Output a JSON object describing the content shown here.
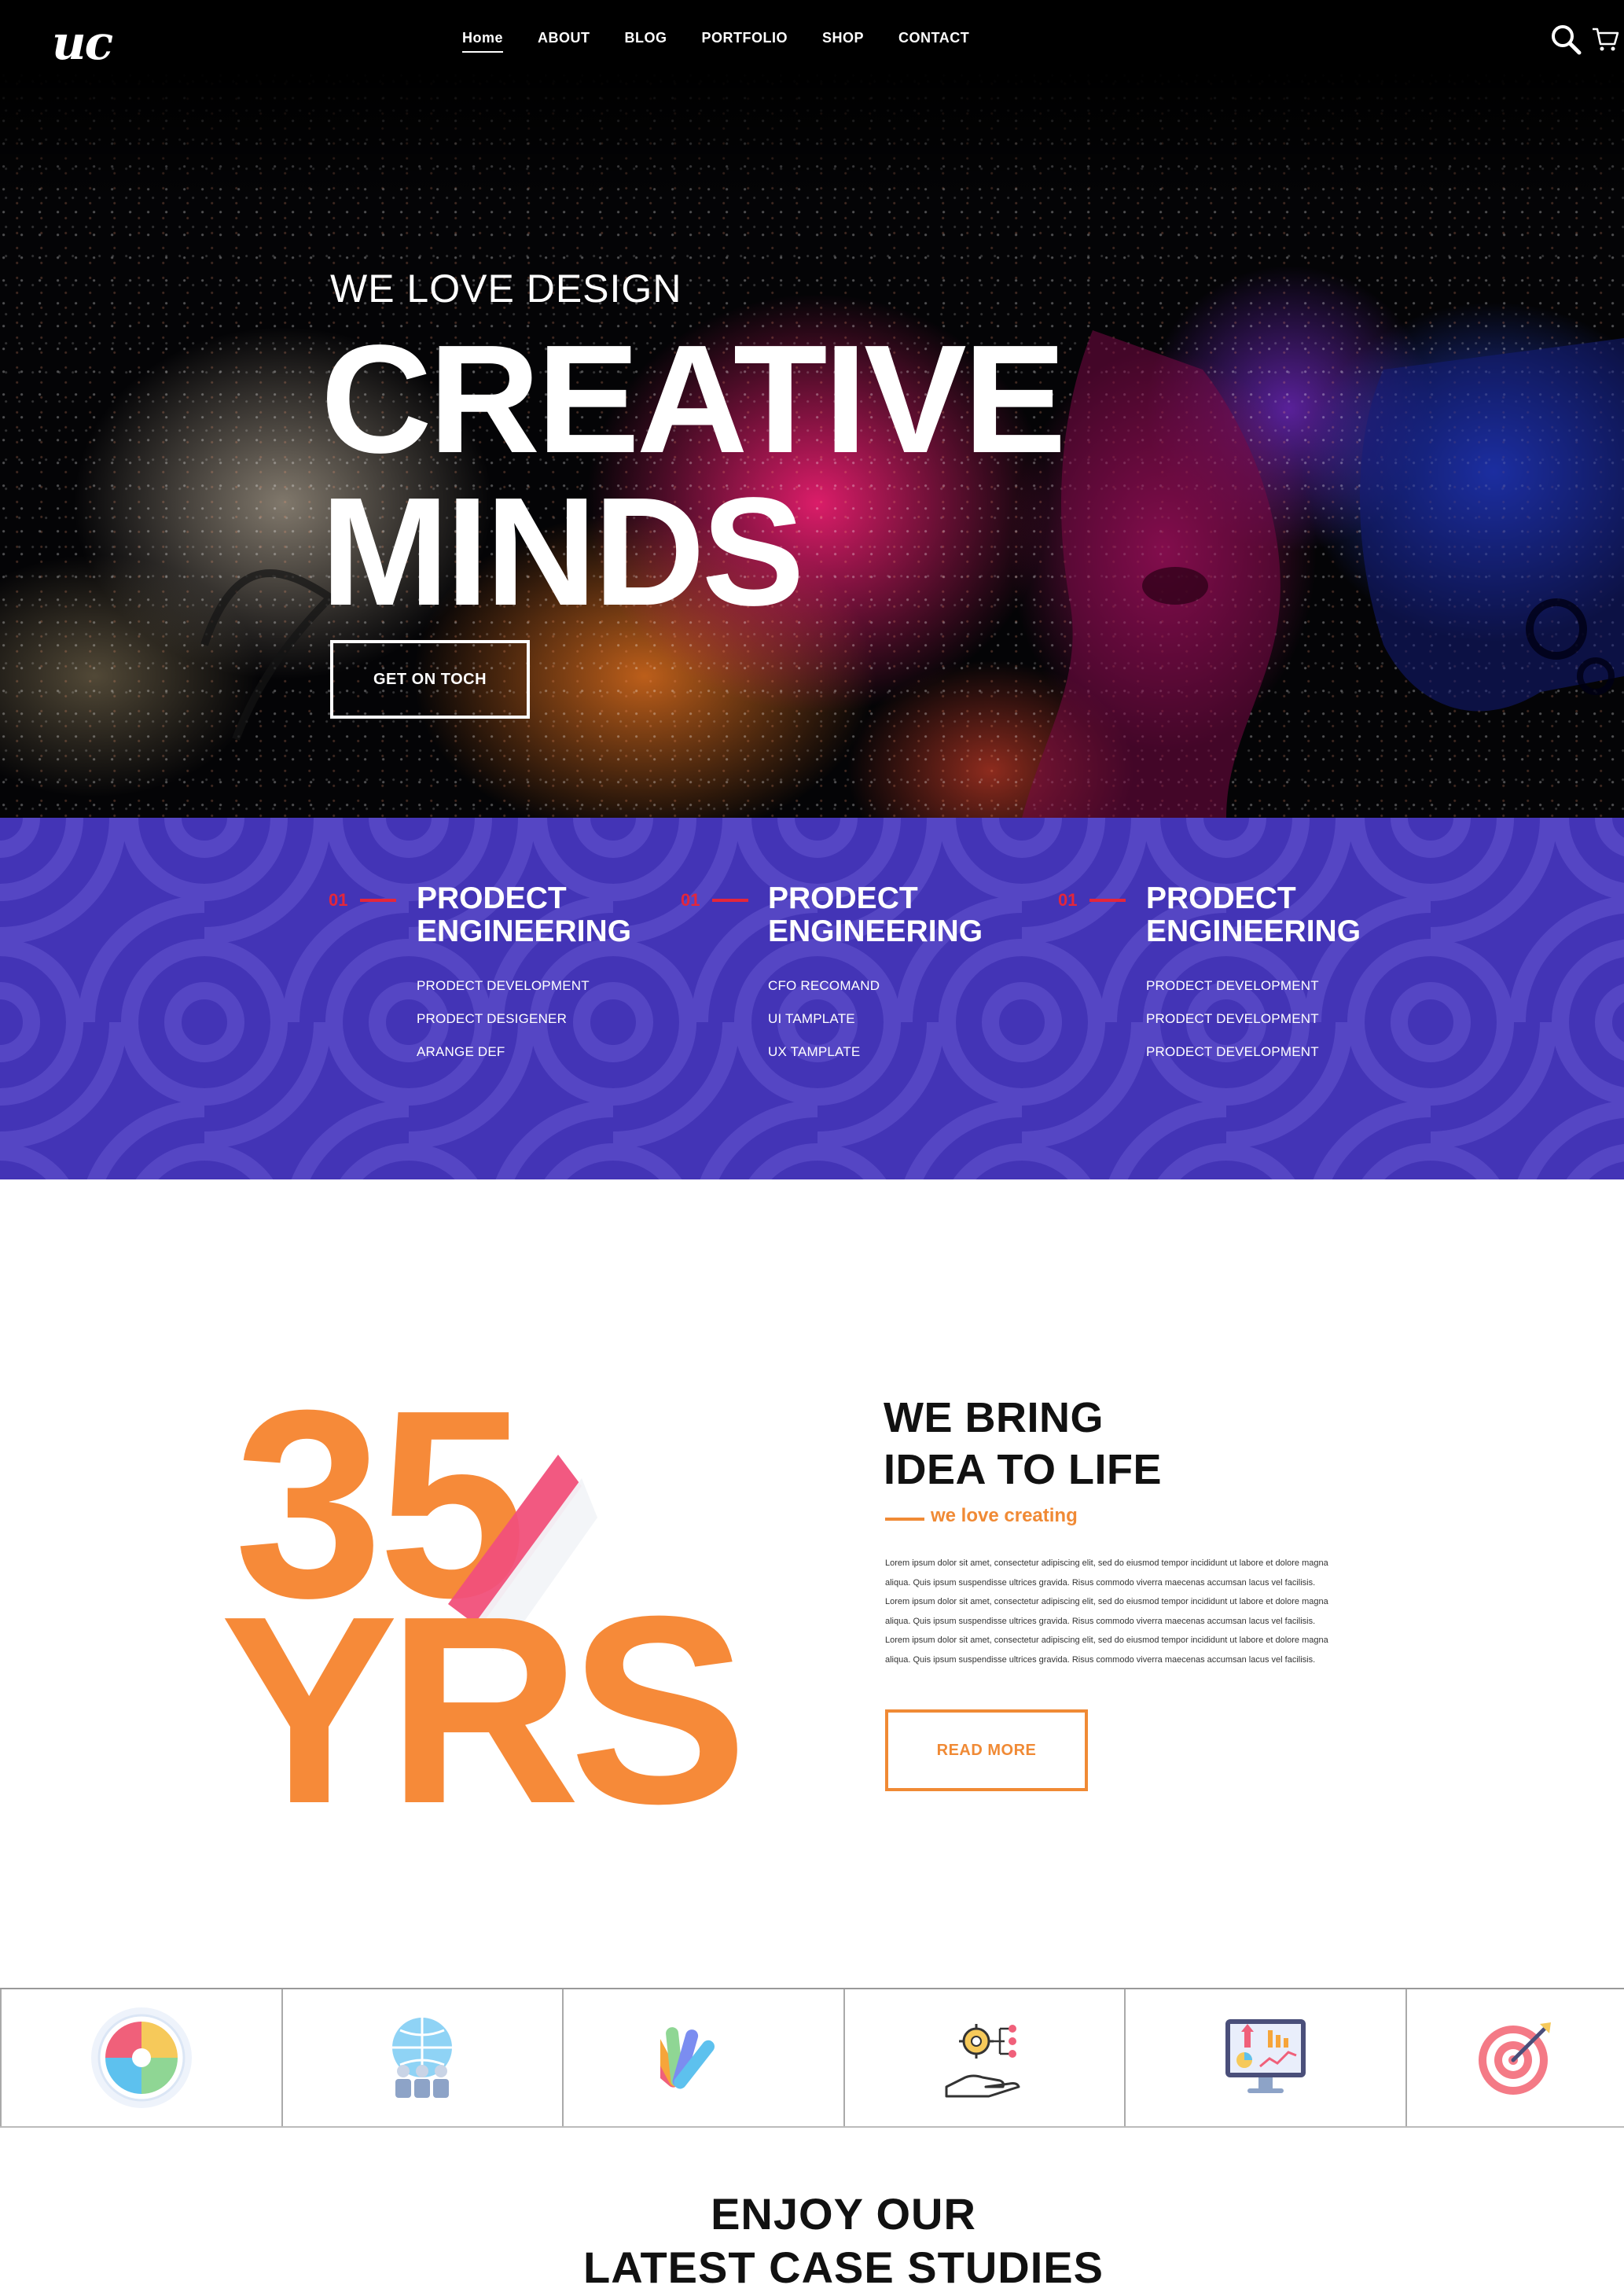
{
  "brand": {
    "logo": "uc"
  },
  "nav": {
    "items": [
      "Home",
      "ABOUT",
      "BLOG",
      "PORTFOLIO",
      "SHOP",
      "CONTACT"
    ]
  },
  "header_icons": {
    "search": "search-icon",
    "cart": "cart-icon"
  },
  "hero": {
    "subtitle": "WE LOVE DESIGN",
    "title_line1": "CREATIVE",
    "title_line2": "MINDS",
    "button": "GET ON TOCH"
  },
  "services": [
    {
      "num": "01",
      "title1": "PRODECT",
      "title2": "ENGINEERING",
      "items": [
        "PRODECT DEVELOPMENT",
        "PRODECT DESIGENER",
        "ARANGE DEF"
      ]
    },
    {
      "num": "01",
      "title1": "PRODECT",
      "title2": "ENGINEERING",
      "items": [
        "CFO RECOMAND",
        "UI TAMPLATE",
        "UX TAMPLATE"
      ]
    },
    {
      "num": "01",
      "title1": "PRODECT",
      "title2": "ENGINEERING",
      "items": [
        "PRODECT DEVELOPMENT",
        "PRODECT DEVELOPMENT",
        "PRODECT DEVELOPMENT"
      ]
    }
  ],
  "about": {
    "graphic": {
      "num": "35",
      "word": "YRS"
    },
    "heading1": "WE BRING",
    "heading2": "IDEA TO LIFE",
    "tagline": "we love creating",
    "body": "Lorem ipsum dolor sit amet, consectetur adipiscing elit, sed do eiusmod tempor incididunt ut labore et dolore magna aliqua. Quis ipsum suspendisse ultrices gravida. Risus commodo viverra maecenas accumsan lacus vel facilisis. Lorem ipsum dolor sit amet, consectetur adipiscing elit, sed do eiusmod tempor incididunt ut labore et dolore magna aliqua. Quis ipsum suspendisse ultrices gravida. Risus commodo viverra maecenas accumsan lacus vel facilisis. Lorem ipsum dolor sit amet, consectetur adipiscing elit, sed do eiusmod tempor incididunt ut labore et dolore magna aliqua. Quis ipsum suspendisse ultrices gravida. Risus commodo viverra maecenas accumsan lacus vel facilisis.",
    "button": "READ MORE"
  },
  "feature_icons": [
    "puzzle-icon",
    "global-team-icon",
    "color-palette-icon",
    "gear-hand-icon",
    "analytics-monitor-icon",
    "target-icon"
  ],
  "case_studies": {
    "heading1": "ENJOY OUR",
    "heading2": "LATEST CASE STUDIES"
  },
  "colors": {
    "accent_orange": "#f08a35",
    "accent_red": "#e5263a",
    "band_purple": "#4334b6",
    "light_blue": "#8fd3f5"
  }
}
